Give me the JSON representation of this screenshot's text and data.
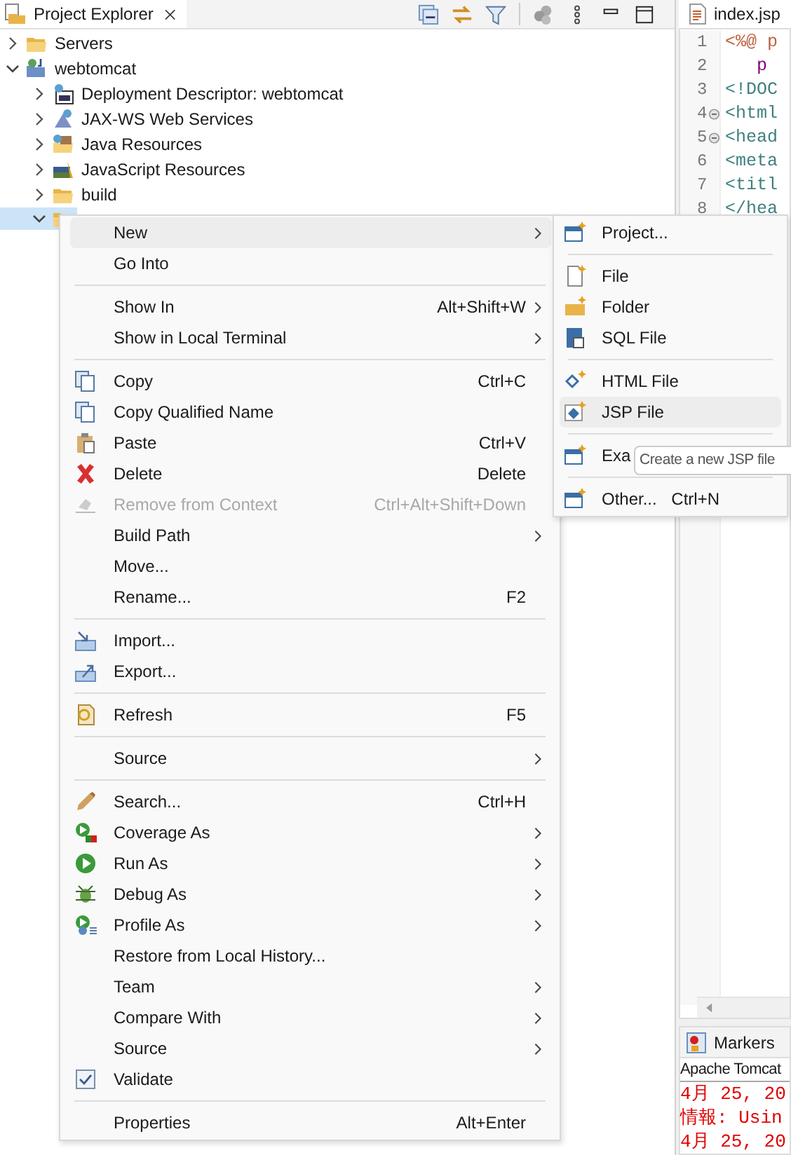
{
  "explorer": {
    "tab": {
      "label": "Project Explorer"
    },
    "tree": [
      {
        "label": "Servers",
        "expanded": false,
        "selected": false
      },
      {
        "label": "webtomcat",
        "expanded": true,
        "selected": false,
        "children": [
          {
            "label": "Deployment Descriptor: webtomcat",
            "expanded": false,
            "selected": false
          },
          {
            "label": "JAX-WS Web Services",
            "expanded": false,
            "selected": false
          },
          {
            "label": "Java Resources",
            "expanded": false,
            "selected": false
          },
          {
            "label": "JavaScript Resources",
            "expanded": false,
            "selected": false
          },
          {
            "label": "build",
            "expanded": false,
            "selected": false
          },
          {
            "expanded": true,
            "selected": true
          }
        ]
      }
    ]
  },
  "context_menu": {
    "items": [
      {
        "kind": "item",
        "label": "New",
        "submenu": true,
        "selected": true,
        "disabled": false
      },
      {
        "kind": "item",
        "label": "Go Into",
        "selected": false,
        "disabled": false
      },
      {
        "kind": "separator"
      },
      {
        "kind": "item",
        "label": "Show In",
        "shortcut": "Alt+Shift+W",
        "submenu": true,
        "selected": false,
        "disabled": false
      },
      {
        "kind": "item",
        "label": "Show in Local Terminal",
        "submenu": true,
        "selected": false,
        "disabled": false
      },
      {
        "kind": "separator"
      },
      {
        "kind": "item",
        "label": "Copy",
        "shortcut": "Ctrl+C",
        "selected": false,
        "disabled": false
      },
      {
        "kind": "item",
        "label": "Copy Qualified Name",
        "selected": false,
        "disabled": false
      },
      {
        "kind": "item",
        "label": "Paste",
        "shortcut": "Ctrl+V",
        "selected": false,
        "disabled": false
      },
      {
        "kind": "item",
        "label": "Delete",
        "shortcut": "Delete",
        "selected": false,
        "disabled": false
      },
      {
        "kind": "item",
        "label": "Remove from Context",
        "shortcut": "Ctrl+Alt+Shift+Down",
        "selected": false,
        "disabled": true
      },
      {
        "kind": "item",
        "label": "Build Path",
        "submenu": true,
        "selected": false,
        "disabled": false
      },
      {
        "kind": "item",
        "label": "Move...",
        "selected": false,
        "disabled": false
      },
      {
        "kind": "item",
        "label": "Rename...",
        "shortcut": "F2",
        "selected": false,
        "disabled": false
      },
      {
        "kind": "separator"
      },
      {
        "kind": "item",
        "label": "Import...",
        "selected": false,
        "disabled": false
      },
      {
        "kind": "item",
        "label": "Export...",
        "selected": false,
        "disabled": false
      },
      {
        "kind": "separator"
      },
      {
        "kind": "item",
        "label": "Refresh",
        "shortcut": "F5",
        "selected": false,
        "disabled": false
      },
      {
        "kind": "separator"
      },
      {
        "kind": "item",
        "label": "Source",
        "submenu": true,
        "selected": false,
        "disabled": false
      },
      {
        "kind": "separator"
      },
      {
        "kind": "item",
        "label": "Search...",
        "shortcut": "Ctrl+H",
        "selected": false,
        "disabled": false
      },
      {
        "kind": "item",
        "label": "Coverage As",
        "submenu": true,
        "selected": false,
        "disabled": false
      },
      {
        "kind": "item",
        "label": "Run As",
        "submenu": true,
        "selected": false,
        "disabled": false
      },
      {
        "kind": "item",
        "label": "Debug As",
        "submenu": true,
        "selected": false,
        "disabled": false
      },
      {
        "kind": "item",
        "label": "Profile As",
        "submenu": true,
        "selected": false,
        "disabled": false
      },
      {
        "kind": "item",
        "label": "Restore from Local History...",
        "selected": false,
        "disabled": false
      },
      {
        "kind": "item",
        "label": "Team",
        "submenu": true,
        "selected": false,
        "disabled": false
      },
      {
        "kind": "item",
        "label": "Compare With",
        "submenu": true,
        "selected": false,
        "disabled": false
      },
      {
        "kind": "item",
        "label": "Source",
        "submenu": true,
        "selected": false,
        "disabled": false
      },
      {
        "kind": "check",
        "label": "Validate",
        "checked": true,
        "selected": false,
        "disabled": false
      },
      {
        "kind": "separator"
      },
      {
        "kind": "item",
        "label": "Properties",
        "shortcut": "Alt+Enter",
        "selected": false,
        "disabled": false
      }
    ]
  },
  "new_submenu": {
    "items": [
      {
        "kind": "item",
        "label": "Project...",
        "selected": false
      },
      {
        "kind": "separator"
      },
      {
        "kind": "item",
        "label": "File",
        "selected": false
      },
      {
        "kind": "item",
        "label": "Folder",
        "selected": false
      },
      {
        "kind": "item",
        "label": "SQL File",
        "selected": false
      },
      {
        "kind": "separator"
      },
      {
        "kind": "item",
        "label": "HTML File",
        "selected": false
      },
      {
        "kind": "item",
        "label": "JSP File",
        "selected": true
      },
      {
        "kind": "separator"
      },
      {
        "kind": "item",
        "label": "Exa",
        "selected": false
      },
      {
        "kind": "separator"
      },
      {
        "kind": "item",
        "label": "Other...",
        "shortcut": "Ctrl+N",
        "selected": false
      }
    ]
  },
  "tooltip": "Create a new JSP file",
  "editor": {
    "tab": {
      "label": "index.jsp"
    },
    "lines": [
      {
        "number": "1",
        "kind": "directive",
        "text": "<%@ p"
      },
      {
        "number": "2",
        "kind": "attribute",
        "text": "   p"
      },
      {
        "number": "3",
        "kind": "tag",
        "text": "<!DOC"
      },
      {
        "number": "4",
        "kind": "tag",
        "text": "<html",
        "foldable": true
      },
      {
        "number": "5",
        "kind": "tag",
        "text": "<head",
        "foldable": true
      },
      {
        "number": "6",
        "kind": "tag",
        "text": "<meta"
      },
      {
        "number": "7",
        "kind": "tag",
        "text": "<titl"
      },
      {
        "number": "8",
        "kind": "tag",
        "text": "</hea"
      }
    ]
  },
  "bottom_panel": {
    "tab": {
      "label": "Markers"
    },
    "console_title": "Apache Tomcat",
    "console_lines": [
      "4月 25, 20",
      "情報: Usin",
      "4月 25, 20"
    ]
  }
}
